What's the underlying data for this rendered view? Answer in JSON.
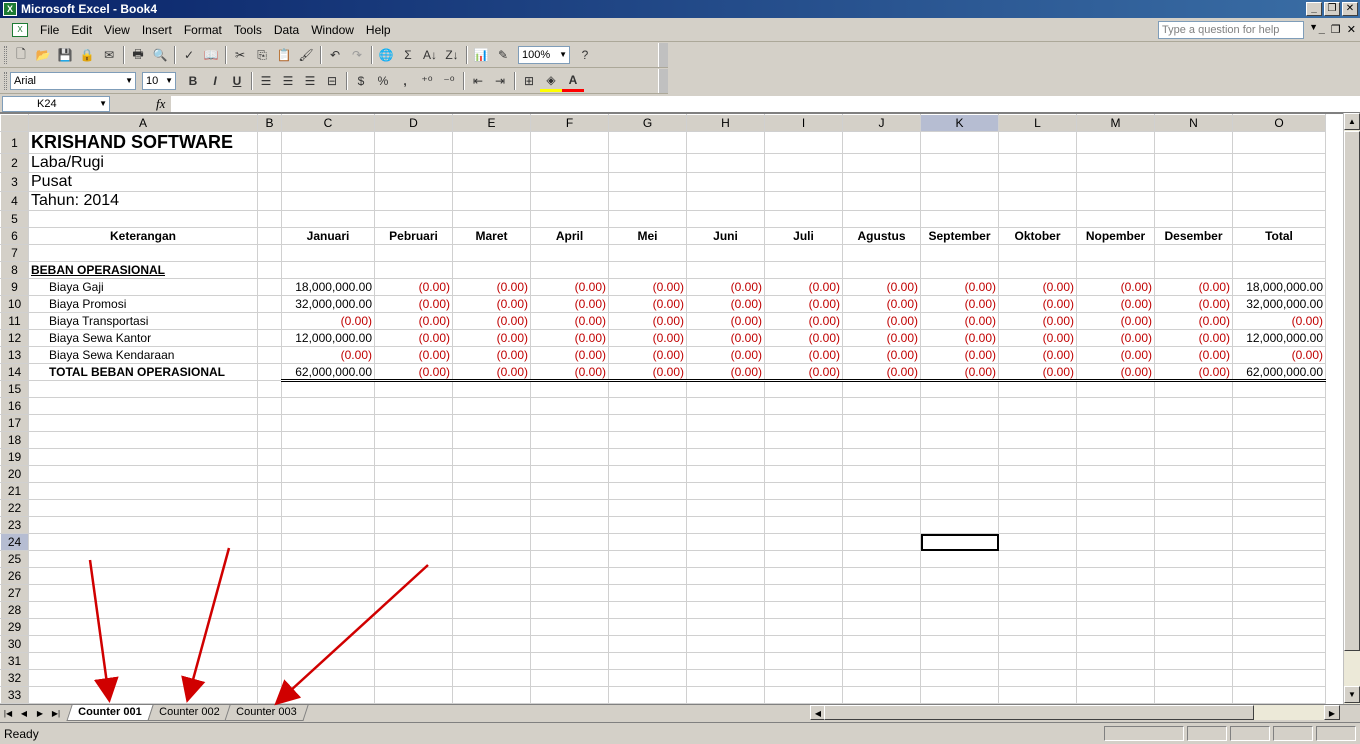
{
  "window": {
    "title": "Microsoft Excel - Book4"
  },
  "menu": [
    "File",
    "Edit",
    "View",
    "Insert",
    "Format",
    "Tools",
    "Data",
    "Window",
    "Help"
  ],
  "help": {
    "placeholder": "Type a question for help"
  },
  "toolbar": {
    "zoom": "100%",
    "font": "Arial",
    "size": "10",
    "bold": "B",
    "italic": "I",
    "underline": "U",
    "currency": "$",
    "percent": "%",
    "comma": ","
  },
  "namebox": "K24",
  "fx": "fx",
  "columns": [
    "A",
    "B",
    "C",
    "D",
    "E",
    "F",
    "G",
    "H",
    "I",
    "J",
    "K",
    "L",
    "M",
    "N",
    "O"
  ],
  "active_column": "K",
  "active_row": 24,
  "sheet": {
    "company": "KRISHAND SOFTWARE",
    "report": "Laba/Rugi",
    "branch": "Pusat",
    "year": "Tahun: 2014",
    "header_label": "Keterangan",
    "months": [
      "Januari",
      "Pebruari",
      "Maret",
      "April",
      "Mei",
      "Juni",
      "Juli",
      "Agustus",
      "September",
      "Oktober",
      "Nopember",
      "Desember",
      "Total"
    ],
    "section": "BEBAN OPERASIONAL",
    "rows": [
      {
        "label": "Biaya Gaji",
        "jan": "18,000,000.00",
        "total": "18,000,000.00"
      },
      {
        "label": "Biaya Promosi",
        "jan": "32,000,000.00",
        "total": "32,000,000.00"
      },
      {
        "label": "Biaya Transportasi",
        "jan": "(0.00)",
        "total": "(0.00)"
      },
      {
        "label": "Biaya Sewa Kantor",
        "jan": "12,000,000.00",
        "total": "12,000,000.00"
      },
      {
        "label": "Biaya Sewa Kendaraan",
        "jan": "(0.00)",
        "total": "(0.00)"
      }
    ],
    "total_row": {
      "label": "TOTAL BEBAN OPERASIONAL",
      "jan": "62,000,000.00",
      "total": "62,000,000.00"
    },
    "zero": "(0.00)"
  },
  "tabs": [
    "Counter 001",
    "Counter 002",
    "Counter 003"
  ],
  "active_tab": 0,
  "status": "Ready"
}
